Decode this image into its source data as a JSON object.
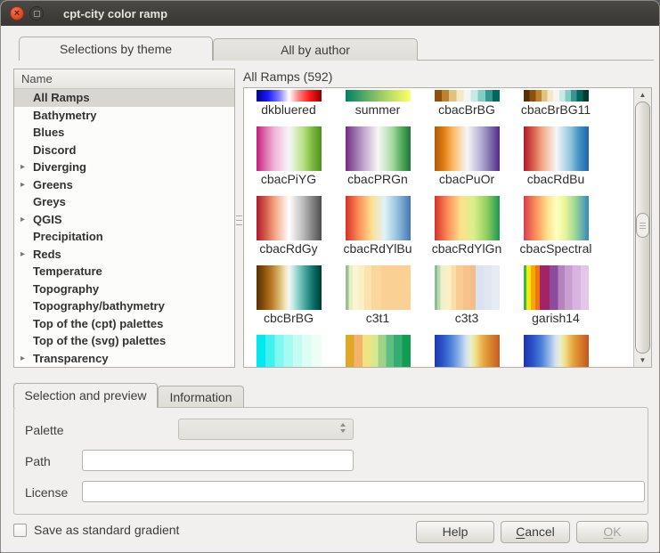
{
  "window": {
    "title": "cpt-city color ramp"
  },
  "titlebar": {
    "close_glyph": "×"
  },
  "top_tabs": [
    {
      "label": "Selections by theme",
      "active": true
    },
    {
      "label": "All by author",
      "active": false
    }
  ],
  "tree": {
    "header": "Name",
    "items": [
      {
        "label": "All Ramps",
        "selected": true,
        "expandable": false
      },
      {
        "label": "Bathymetry",
        "selected": false,
        "expandable": false
      },
      {
        "label": "Blues",
        "selected": false,
        "expandable": false
      },
      {
        "label": "Discord",
        "selected": false,
        "expandable": false
      },
      {
        "label": "Diverging",
        "selected": false,
        "expandable": true
      },
      {
        "label": "Greens",
        "selected": false,
        "expandable": true
      },
      {
        "label": "Greys",
        "selected": false,
        "expandable": false
      },
      {
        "label": "QGIS",
        "selected": false,
        "expandable": true
      },
      {
        "label": "Precipitation",
        "selected": false,
        "expandable": false
      },
      {
        "label": "Reds",
        "selected": false,
        "expandable": true
      },
      {
        "label": "Temperature",
        "selected": false,
        "expandable": false
      },
      {
        "label": "Topography",
        "selected": false,
        "expandable": false
      },
      {
        "label": "Topography/bathymetry",
        "selected": false,
        "expandable": false
      },
      {
        "label": "Top of the (cpt) palettes",
        "selected": false,
        "expandable": false
      },
      {
        "label": "Top of the (svg) palettes",
        "selected": false,
        "expandable": false
      },
      {
        "label": "Transparency",
        "selected": false,
        "expandable": true
      }
    ]
  },
  "ramps": {
    "header": "All Ramps (592)",
    "rows": [
      {
        "kind": "partial-top",
        "items": [
          {
            "name": "dkbluered",
            "gradient": "linear-gradient(90deg,#00008C 0%,#1A1AFF 18%,#8080FF 35%,#FFFFFF 50%,#FF8080 65%,#FF1A1A 82%,#8C0000 100%)"
          },
          {
            "name": "summer",
            "gradient": "linear-gradient(90deg,#008066,#66B266 35%,#B2D966 65%,#FFFF66)"
          },
          {
            "name": "cbacBrBG",
            "gradient": "linear-gradient(90deg,#8C510A 0 11.1%,#BF812D 11.1% 22.2%,#DFC27D 22.2% 33.3%,#F6E8C3 33.3% 44.4%,#F5F5F5 44.4% 55.6%,#C7EAE5 55.6% 66.7%,#80CDC1 66.7% 77.8%,#35978F 77.8% 88.9%,#01665E 88.9% 100%)"
          },
          {
            "name": "cbacBrBG11",
            "gradient": "linear-gradient(90deg,#543005 0 9.1%,#8C510A 9.1% 18.2%,#BF812D 18.2% 27.3%,#DFC27D 27.3% 36.4%,#F6E8C3 36.4% 45.5%,#F5F5F5 45.5% 54.5%,#C7EAE5 54.5% 63.6%,#80CDC1 63.6% 72.7%,#35978F 72.7% 81.8%,#01665E 81.8% 90.9%,#003C30 90.9% 100%)"
          }
        ]
      },
      {
        "kind": "full",
        "items": [
          {
            "name": "cbacPiYG",
            "gradient": "linear-gradient(90deg,#C51B7D,#DE77AE 15%,#F1B6DA 28%,#F7F7F7 50%,#B8E186 72%,#7FBC41 85%,#4D9221)"
          },
          {
            "name": "cbacPRGn",
            "gradient": "linear-gradient(90deg,#762A83,#9970AB 15%,#C2A5CF 28%,#F7F7F7 50%,#A6DBA0 72%,#5AAE61 85%,#1B7837)"
          },
          {
            "name": "cbacPuOr",
            "gradient": "linear-gradient(90deg,#B35806,#E08214 15%,#FDB863 28%,#F7F7F7 50%,#B2ABD2 72%,#8073AC 85%,#542788)"
          },
          {
            "name": "cbacRdBu",
            "gradient": "linear-gradient(90deg,#B2182B,#D6604D 15%,#F4A582 28%,#F7F7F7 50%,#92C5DE 72%,#4393C3 85%,#2166AC)"
          }
        ]
      },
      {
        "kind": "full",
        "items": [
          {
            "name": "cbacRdGy",
            "gradient": "linear-gradient(90deg,#B2182B,#D6604D 15%,#F4A582 28%,#FFFFFF 50%,#BABABA 72%,#878787 85%,#4D4D4D)"
          },
          {
            "name": "cbacRdYlBu",
            "gradient": "linear-gradient(90deg,#D73027,#FC8D59 20%,#FEE090 40%,#E0F3F8 60%,#91BFDB 80%,#4575B4)"
          },
          {
            "name": "cbacRdYlGn",
            "gradient": "linear-gradient(90deg,#D73027,#FC8D59 20%,#FEE08B 40%,#D9EF8B 60%,#91CF60 80%,#1A9850)"
          },
          {
            "name": "cbacSpectral",
            "gradient": "linear-gradient(90deg,#D53E4F,#FC8D59 18%,#FEE08B 36%,#FFFFBF 50%,#E6F598 64%,#99D594 80%,#3288BD)"
          }
        ]
      },
      {
        "kind": "full",
        "items": [
          {
            "name": "cbcBrBG",
            "gradient": "linear-gradient(90deg,#543005,#8C510A 12%,#BF812D 25%,#DFC27D 37%,#F6E8C3 45%,#F5F5F5 50%,#C7EAE5 56%,#80CDC1 65%,#35978F 78%,#01665E 90%,#003C30)"
          },
          {
            "name": "c3t1",
            "gradient": "linear-gradient(90deg,#9CBE98 0 5%,#E6EFC2 5% 11%,#FAF5D2 11% 20%,#FBEFC4 20% 29%,#FBE3B0 29% 40%,#FBD79E 40% 55%,#FBD094 55% 100%)"
          },
          {
            "name": "c3t3",
            "gradient": "linear-gradient(90deg,#8FBC94 0 4%,#BCDAB2 4% 9%,#F0F1CC 9% 17%,#FBF0C4 17% 25%,#FBDFA8 25% 33%,#FACB93 33% 44%,#F7C28C 44% 55%,#F3BD89 55% 63%,#DAE2F0 63% 76%,#E0E7F3 76% 88%,#E6ECF6 88% 100%)"
          },
          {
            "name": "garish14",
            "gradient": "linear-gradient(90deg,#3DB54A 0 4%,#F2E90F 4% 11%,#F6A803 11% 18%,#ED7612 18% 25%,#A32367 25% 40%,#8C4B9E 40% 53%,#B583BE 53% 63%,#C99FD2 63% 75%,#D9B4E0 75% 88%,#E3C6E9 88% 100%)"
          }
        ]
      },
      {
        "kind": "partial-bottom",
        "items": [
          {
            "name": "",
            "gradient": "linear-gradient(90deg,#00E8F0 0 14%,#3FF2F0 14% 28%,#7FF8F2 28% 42%,#A5FAF2 42% 56%,#C4FCF3 56% 70%,#DCFDF4 70% 84%,#EDFEF7 84% 100%)"
          },
          {
            "name": "",
            "gradient": "linear-gradient(90deg,#DFA827 0 13%,#F4B26A 13% 26%,#EFE382 26% 39%,#D9E88F 39% 50%,#9ED389 50% 62%,#5FBF80 62% 74%,#35AC74 74% 87%,#0F9E4F 87% 100%)"
          },
          {
            "name": "",
            "gradient": "linear-gradient(90deg,#2038B0 0%,#2B52C6 12%,#4F83DC 26%,#8FB4E8 38%,#CFDFF0 48%,#E9EFD2 55%,#EFE18C 63%,#E8B04A 73%,#DA8A2E 84%,#C65B20 100%)"
          },
          {
            "name": "",
            "gradient": "linear-gradient(90deg,#1E34AC 0%,#2B52C6 14%,#4F83DC 28%,#97BAEA 40%,#D5E3F1 49%,#EAEFCF 56%,#EFDE85 64%,#E7AC45 74%,#D9842B 85%,#C4561E 100%)"
          }
        ]
      }
    ]
  },
  "bottom_tabs": [
    {
      "label": "Selection and preview",
      "active": true
    },
    {
      "label": "Information",
      "active": false
    }
  ],
  "form": {
    "palette_label": "Palette",
    "palette_value": "",
    "path_label": "Path",
    "path_value": "",
    "license_label": "License",
    "license_value": ""
  },
  "footer": {
    "checkbox_label": "Save as standard gradient",
    "checkbox_checked": false,
    "buttons": [
      {
        "id": "help",
        "label": "Help",
        "underline_first": false,
        "enabled": true
      },
      {
        "id": "cancel",
        "label": "Cancel",
        "underline_first": true,
        "enabled": true
      },
      {
        "id": "ok",
        "label": "OK",
        "underline_first": true,
        "enabled": false
      }
    ]
  },
  "colors": {
    "titlebar_bg": "#3B3A36",
    "close_button": "#DF4B28",
    "dialog_bg": "#F1F0EE",
    "tree_selection_bg": "#D8D6D1",
    "text": "#3C3C3C"
  }
}
